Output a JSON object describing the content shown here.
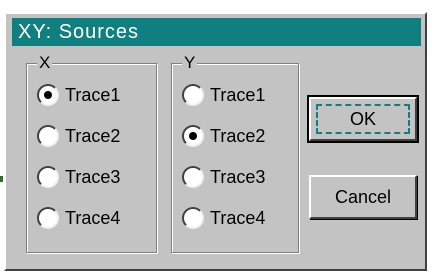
{
  "dialog": {
    "title": "XY: Sources"
  },
  "groups": {
    "x": {
      "legend": "X",
      "options": [
        {
          "label": "Trace1",
          "checked": true
        },
        {
          "label": "Trace2",
          "checked": false
        },
        {
          "label": "Trace3",
          "checked": false
        },
        {
          "label": "Trace4",
          "checked": false
        }
      ]
    },
    "y": {
      "legend": "Y",
      "options": [
        {
          "label": "Trace1",
          "checked": false
        },
        {
          "label": "Trace2",
          "checked": true
        },
        {
          "label": "Trace3",
          "checked": false
        },
        {
          "label": "Trace4",
          "checked": false
        }
      ]
    }
  },
  "buttons": {
    "ok_label": "OK",
    "cancel_label": "Cancel"
  },
  "colors": {
    "titlebar": "#0f7f7f",
    "dialog_face": "#c3c3c3"
  }
}
